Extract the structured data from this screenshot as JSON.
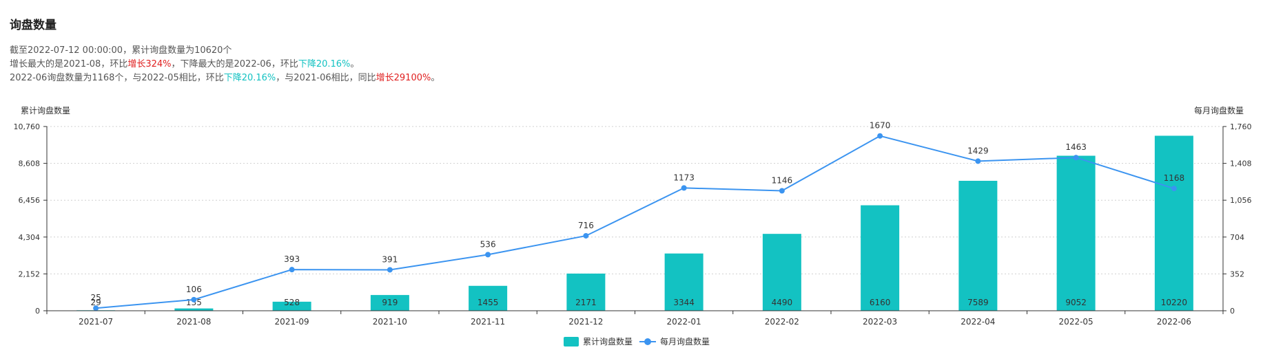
{
  "page": {
    "title": "询盘数量",
    "summary": {
      "line1": "截至2022-07-12 00:00:00，累计询盘数量为10620个",
      "line2": {
        "pre": "增长最大的是2021-08，环比",
        "up": "增长324%",
        "mid": "，下降最大的是2022-06，环比",
        "down": "下降20.16%",
        "post": "。"
      },
      "line3": {
        "pre": "2022-06询盘数量为1168个，与2022-05相比，环比",
        "down": "下降20.16%",
        "mid": "，与2021-06相比，同比",
        "up": "增长29100%",
        "post": "。"
      }
    },
    "colors": {
      "bar": "#13c2c2",
      "line": "#3b94f0",
      "up": "#e02020",
      "down": "#13c2c2"
    }
  },
  "chart_data": {
    "type": "bar",
    "categories": [
      "2021-07",
      "2021-08",
      "2021-09",
      "2021-10",
      "2021-11",
      "2021-12",
      "2022-01",
      "2022-02",
      "2022-03",
      "2022-04",
      "2022-05",
      "2022-06"
    ],
    "series": [
      {
        "name": "累计询盘数量",
        "type": "bar",
        "axis": "left",
        "values": [
          29,
          135,
          528,
          919,
          1455,
          2171,
          3344,
          4490,
          6160,
          7589,
          9052,
          10220
        ]
      },
      {
        "name": "每月询盘数量",
        "type": "line",
        "axis": "right",
        "values": [
          25,
          106,
          393,
          391,
          536,
          716,
          1173,
          1146,
          1670,
          1429,
          1463,
          1168
        ]
      }
    ],
    "ylabel_left": "累计询盘数量",
    "ylabel_right": "每月询盘数量",
    "ylim_left": [
      0,
      10760
    ],
    "ylim_right": [
      0,
      1760
    ],
    "yticks_left": [
      "0",
      "2,152",
      "4,304",
      "6,456",
      "8,608",
      "10,760"
    ],
    "yticks_right": [
      "0",
      "352",
      "704",
      "1,056",
      "1,408",
      "1,760"
    ],
    "grid": true,
    "legend_position": "bottom-center"
  }
}
